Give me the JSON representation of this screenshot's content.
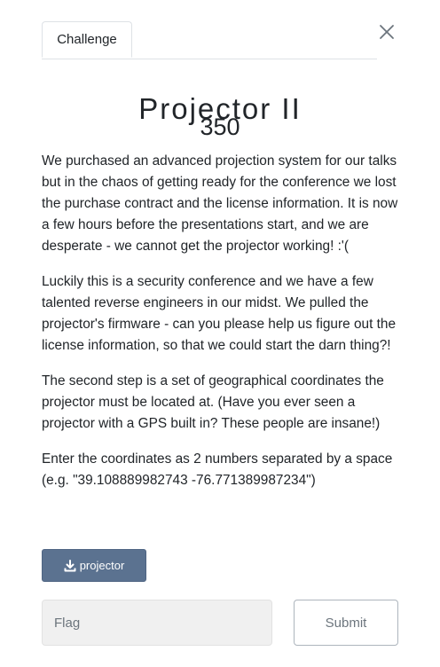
{
  "tabs": [
    {
      "label": "Challenge"
    }
  ],
  "challenge": {
    "name": "Projector II",
    "value": "350",
    "description": [
      "We purchased an advanced projection system for our talks but in the chaos of getting ready for the conference we lost the purchase contract and the license information. It is now a few hours before the presentations start, and we are desperate - we cannot get the projector working! :'(",
      "Luckily this is a security conference and we have a few talented reverse engineers in our midst. We pulled the projector's firmware - can you please help us figure out the license information, so that we could start the darn thing?!",
      "The second step is a set of geographical coordinates the projector must be located at. (Have you ever seen a projector with a GPS built in? These people are insane!)",
      "Enter the coordinates as 2 numbers separated by a space (e.g. \"39.108889982743 -76.771389987234\")"
    ]
  },
  "files": [
    {
      "label": "projector",
      "icon": "download-icon"
    }
  ],
  "form": {
    "flag_placeholder": "Flag",
    "flag_value": "",
    "submit_label": "Submit"
  },
  "colors": {
    "download_button": "#5b7290",
    "input_background": "#f0f0f0",
    "submit_border": "#adb5bd"
  }
}
